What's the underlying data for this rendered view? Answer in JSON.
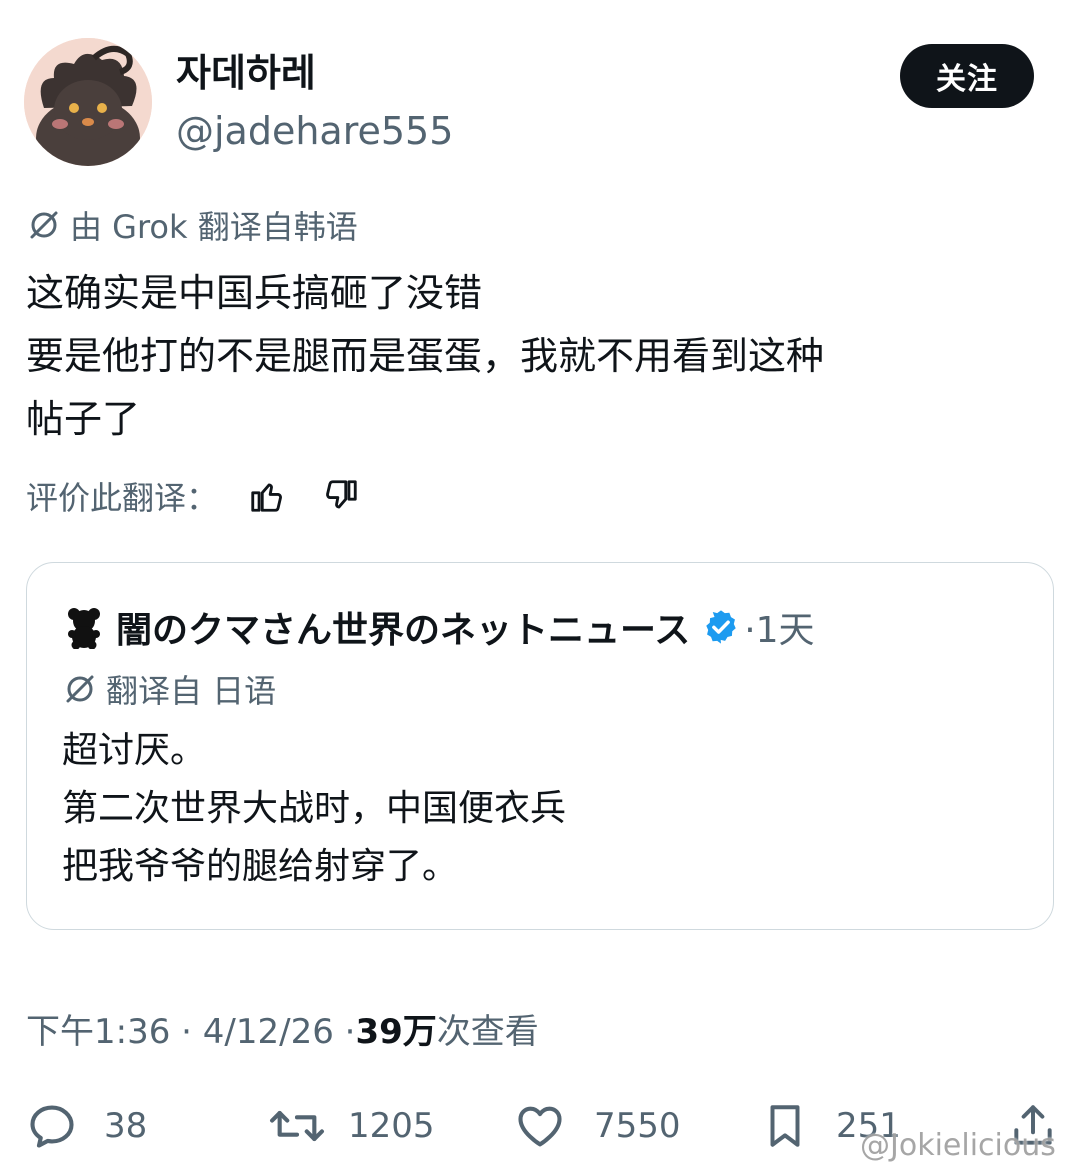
{
  "author": {
    "display_name": "자데하레",
    "handle": "@jadehare555",
    "follow_label": "关注"
  },
  "translation_note": "由 Grok 翻译自韩语",
  "tweet_lines": [
    "这确实是中国兵搞砸了没错",
    "要是他打的不是腿而是蛋蛋，我就不用看到这种",
    "帖子了"
  ],
  "rate_label": "评价此翻译：",
  "quote": {
    "name": "闇のクマさん世界のネットニュース",
    "time": "·1天",
    "translation_note": "翻译自 日语",
    "lines": [
      "超讨厌。",
      "第二次世界大战时，中国便衣兵",
      "把我爷爷的腿给射穿了。"
    ]
  },
  "meta": {
    "time": "下午1:36 · 4/12/26 · ",
    "views_count": "39万",
    "views_label": " 次查看"
  },
  "actions": {
    "replies": "38",
    "reposts": "1205",
    "likes": "7550",
    "bookmarks": "251"
  },
  "watermark": "@Jokielicious",
  "colors": {
    "text": "#0f1419",
    "secondary": "#536471",
    "verified": "#1d9bf0",
    "border": "#cfd9de"
  }
}
